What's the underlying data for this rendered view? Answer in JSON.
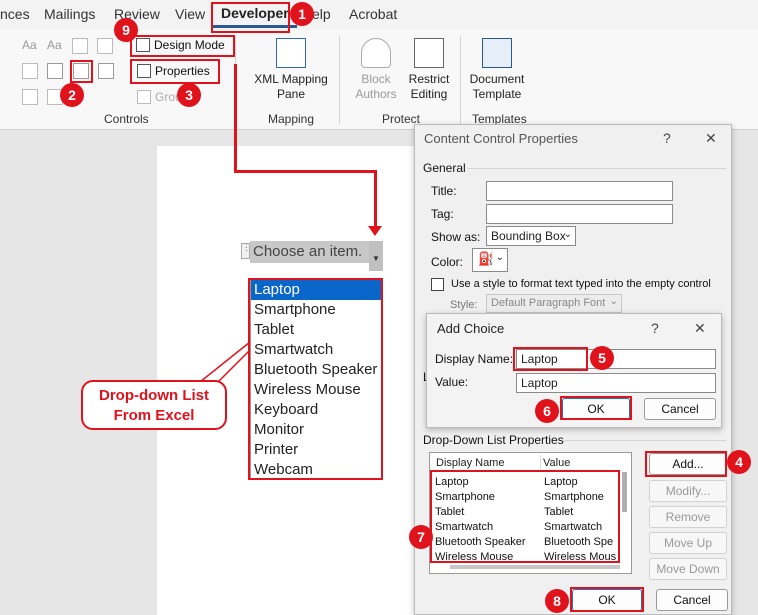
{
  "ribbon": {
    "tabs": [
      {
        "label": "nces"
      },
      {
        "label": "Mailings"
      },
      {
        "label": "Review"
      },
      {
        "label": "View"
      },
      {
        "label": "Developer"
      },
      {
        "label": "elp"
      },
      {
        "label": "Acrobat"
      }
    ],
    "controls_group": {
      "design_mode_label": "Design Mode",
      "properties_label": "Properties",
      "group_label": "Grou",
      "label": "Controls"
    },
    "mapping_group": {
      "xml_button_line1": "XML Mapping",
      "xml_button_line2": "Pane",
      "label": "Mapping"
    },
    "protect_group": {
      "block_line1": "Block",
      "block_line2": "Authors",
      "restrict_line1": "Restrict",
      "restrict_line2": "Editing",
      "label": "Protect"
    },
    "templates_group": {
      "doc_line1": "Document",
      "doc_line2": "Template",
      "label": "Templates"
    }
  },
  "document": {
    "content_control_placeholder": "Choose an item.",
    "dropdown_items": [
      "Laptop",
      "Smartphone",
      "Tablet",
      "Smartwatch",
      "Bluetooth Speaker",
      "Wireless Mouse",
      "Keyboard",
      "Monitor",
      "Printer",
      "Webcam"
    ],
    "selected_item": "Laptop"
  },
  "callout": {
    "line1": "Drop-down List",
    "line2": "From Excel"
  },
  "badges": [
    "1",
    "2",
    "3",
    "4",
    "5",
    "6",
    "7",
    "8",
    "9"
  ],
  "content_control_dialog": {
    "title": "Content Control Properties",
    "help": "?",
    "close": "✕",
    "general_label": "General",
    "title_label": "Title:",
    "tag_label": "Tag:",
    "show_as_label": "Show as:",
    "show_as_value": "Bounding Box",
    "color_label": "Color:",
    "style_checkbox_label": "Use a style to format text typed into the empty control",
    "style_label": "Style:",
    "style_value": "Default Paragraph Font",
    "locking_partial": "L",
    "list_section_label": "Drop-Down List Properties",
    "col_display": "Display Name",
    "col_value": "Value",
    "list_rows": [
      {
        "display": "Laptop",
        "value": "Laptop"
      },
      {
        "display": "Smartphone",
        "value": "Smartphone"
      },
      {
        "display": "Tablet",
        "value": "Tablet"
      },
      {
        "display": "Smartwatch",
        "value": "Smartwatch"
      },
      {
        "display": "Bluetooth Speaker",
        "value": "Bluetooth Spe"
      },
      {
        "display": "Wireless Mouse",
        "value": "Wireless Mous"
      }
    ],
    "add_label": "Add...",
    "modify_label": "Modify...",
    "remove_label": "Remove",
    "move_up_label": "Move Up",
    "move_down_label": "Move Down",
    "ok_label": "OK",
    "cancel_label": "Cancel"
  },
  "add_choice_dialog": {
    "title": "Add Choice",
    "help": "?",
    "close": "✕",
    "display_name_label": "Display Name:",
    "display_name_value": "Laptop",
    "value_label": "Value:",
    "value_value": "Laptop",
    "ok_label": "OK",
    "cancel_label": "Cancel"
  },
  "colors": {
    "annotation_red": "#e0121c",
    "selection_blue": "#0a66c8",
    "accent_blue": "#2b5797"
  }
}
